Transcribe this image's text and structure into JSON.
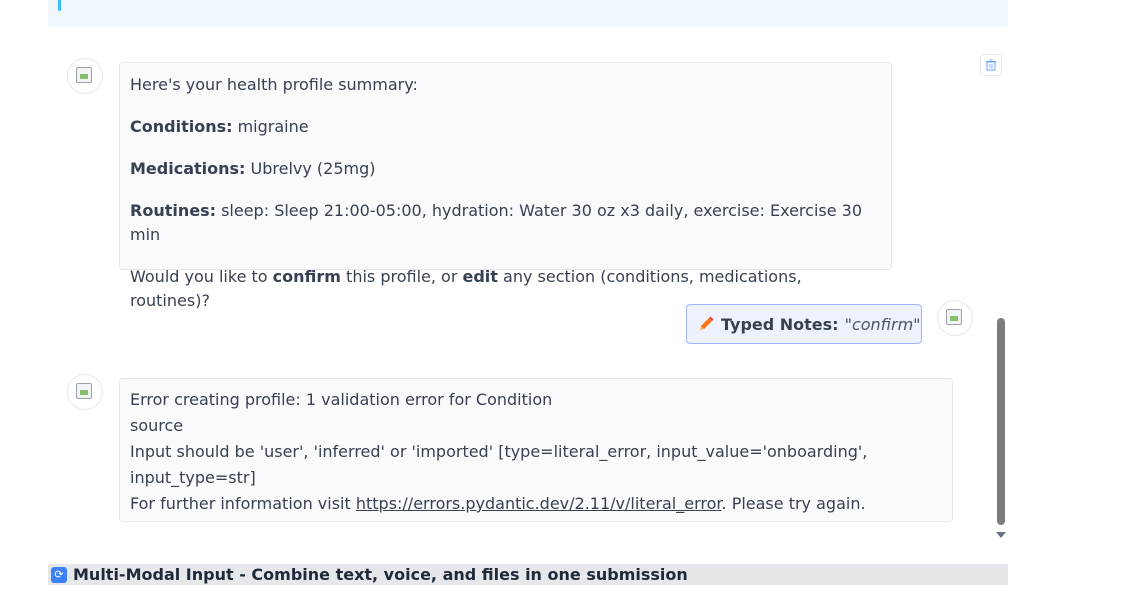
{
  "messages": {
    "summary": {
      "intro": "Here's your health profile summary:",
      "conditions_label": "Conditions:",
      "conditions_value": " migraine",
      "medications_label": "Medications:",
      "medications_value": " Ubrelvy (25mg)",
      "routines_label": "Routines:",
      "routines_value": " sleep: Sleep 21:00-05:00, hydration: Water 30 oz x3 daily, exercise: Exercise 30 min",
      "question_prefix": "Would you like to ",
      "confirm_word": "confirm",
      "question_mid": " this profile, or ",
      "edit_word": "edit",
      "question_suffix": " any section (conditions, medications, routines)?"
    },
    "user_reply": {
      "label": "Typed Notes:",
      "value": "\"confirm\""
    },
    "error": {
      "line1": "Error creating profile: 1 validation error for Condition",
      "line2": "source",
      "line3": "Input should be 'user', 'inferred' or 'imported' [type=literal_error, input_value='onboarding',",
      "line4": "input_type=str]",
      "line5_prefix": "For further information visit ",
      "link_text": "https://errors.pydantic.dev/2.11/v/literal_error",
      "line5_suffix": ". Please try again."
    }
  },
  "footer": {
    "section_title": "Multi-Modal Input - Combine text, voice, and files in one submission",
    "icon": "sync-icon"
  },
  "icons": {
    "delete": "trash-icon",
    "edit": "pencil-icon",
    "scroll": "chevron-down-icon"
  },
  "colors": {
    "accent": "#38bdf8",
    "user_bubble_border": "#a5b4fc",
    "user_bubble_bg": "#eef2ff"
  }
}
